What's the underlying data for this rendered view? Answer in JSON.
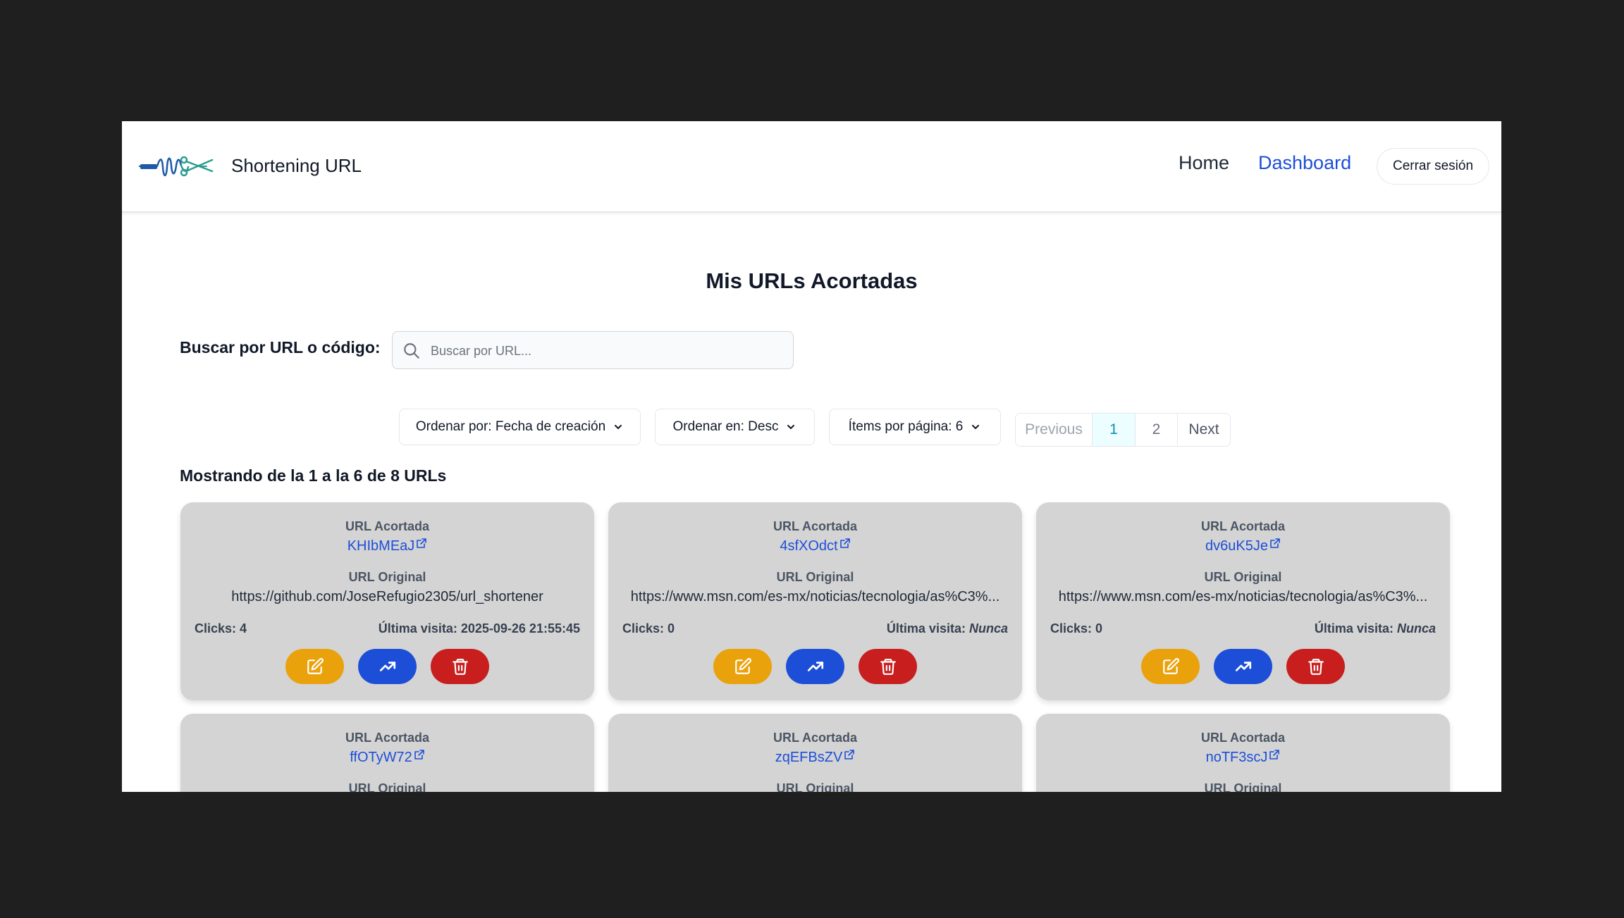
{
  "navbar": {
    "brand": "Shortening URL",
    "home_label": "Home",
    "dashboard_label": "Dashboard",
    "logout_label": "Cerrar sesión",
    "active_color": "#1d4ed8"
  },
  "main": {
    "title": "Mis URLs Acortadas",
    "search_label": "Buscar por URL o código:",
    "search_placeholder": "Buscar por URL...",
    "sort_by": "Ordenar por: Fecha de creación",
    "sort_order": "Ordenar en: Desc",
    "items_per_page": "Ítems por página: 6",
    "showing": "Mostrando de la 1 a la 6 de 8 URLs"
  },
  "pagination": {
    "previous": "Previous",
    "pages": [
      "1",
      "2"
    ],
    "current": "1",
    "next": "Next"
  },
  "card_labels": {
    "short": "URL Acortada",
    "original": "URL Original",
    "clicks_prefix": "Clicks:",
    "last_visit_prefix": "Última visita:"
  },
  "cards": [
    {
      "short_code": "KHIbMEaJ",
      "original_url": "https://github.com/JoseRefugio2305/url_shortener",
      "clicks": "4",
      "last_visit": "2025-09-26 21:55:45"
    },
    {
      "short_code": "4sfXOdct",
      "original_url": "https://www.msn.com/es-mx/noticias/tecnologia/as%C3%...",
      "clicks": "0",
      "last_visit": "Nunca"
    },
    {
      "short_code": "dv6uK5Je",
      "original_url": "https://www.msn.com/es-mx/noticias/tecnologia/as%C3%...",
      "clicks": "0",
      "last_visit": "Nunca"
    },
    {
      "short_code": "ffOTyW72"
    },
    {
      "short_code": "zqEFBsZV"
    },
    {
      "short_code": "noTF3scJ"
    }
  ],
  "colors": {
    "edit_button": "#eaa20c",
    "stats_button": "#1d4ed8",
    "delete_button": "#c81e1e",
    "card_background": "#d4d4d4"
  },
  "icons": {
    "edit": "pencil-square-icon",
    "stats": "trending-up-icon",
    "delete": "trash-icon",
    "external": "external-link-icon",
    "search": "search-icon",
    "dropdown": "chevron-down-icon"
  }
}
